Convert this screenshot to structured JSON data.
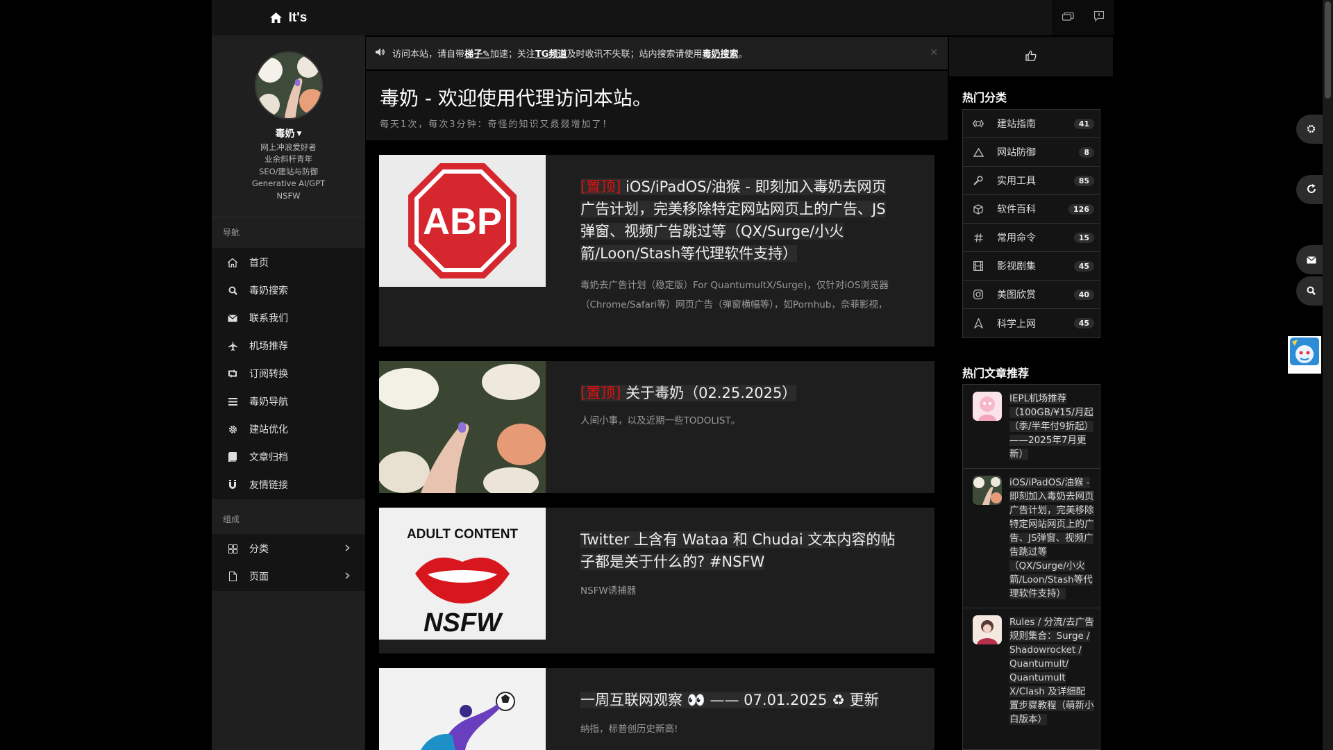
{
  "brand": {
    "title": "It's"
  },
  "profile": {
    "name": "毒奶",
    "bio": [
      "网上冲浪爱好者",
      "业余斜杆青年",
      "SEO/建站与防御",
      "Generative AI/GPT",
      "NSFW"
    ]
  },
  "nav": {
    "heading": "导航",
    "items": [
      {
        "label": "首页",
        "icon": "home-icon"
      },
      {
        "label": "毒奶搜索",
        "icon": "search-icon"
      },
      {
        "label": "联系我们",
        "icon": "envelope-icon"
      },
      {
        "label": "机场推荐",
        "icon": "plane-icon"
      },
      {
        "label": "订阅转换",
        "icon": "retweet-icon"
      },
      {
        "label": "毒奶导航",
        "icon": "list-icon"
      },
      {
        "label": "建站优化",
        "icon": "gear-icon"
      },
      {
        "label": "文章归档",
        "icon": "book-icon"
      },
      {
        "label": "友情链接",
        "icon": "magnet-icon"
      }
    ],
    "group_heading": "组成",
    "group_items": [
      {
        "label": "分类",
        "icon": "grid-icon"
      },
      {
        "label": "页面",
        "icon": "file-icon"
      }
    ]
  },
  "notice": {
    "prefix": "访问本站，请自带",
    "link1": "梯子✎",
    "mid1": "加速；关注 ",
    "link2": "TG频道 ",
    "mid2": "及时收讯不失联；站内搜索请使用",
    "link3": "毒奶搜索",
    "suffix": "。",
    "close": "✕"
  },
  "hero": {
    "title": "毒奶 - 欢迎使用代理访问本站。",
    "subtitle": "每天1次，每次3分钟：奇怪的知识又叒叕增加了！"
  },
  "posts": [
    {
      "pin": "[置顶]",
      "title": "iOS/iPadOS/油猴 - 即刻加入毒奶去网页广告计划，完美移除特定网站网页上的广告、JS弹窗、视频广告跳过等（QX/Surge/小火箭/Loon/Stash等代理软件支持）",
      "desc": "毒奶去广告计划（稳定版）For QuantumultX/Surge)，仅针对iOS浏览器（Chrome/Safari等）网页广告（弹窗横幅等），如Pornhub，奈菲影视，",
      "thumb_text": "ABP"
    },
    {
      "pin": "[置顶]",
      "title": "关于毒奶（02.25.2025）",
      "desc": "人间小事，以及近期一些TODOLIST。"
    },
    {
      "pin": "",
      "title": "Twitter 上含有 Wataa 和 Chudai 文本内容的帖子都是关于什么的? #NSFW",
      "desc": "NSFW诱捕器",
      "thumb_top": "ADULT CONTENT",
      "thumb_bottom": "NSFW"
    },
    {
      "pin": "",
      "title": "一周互联网观察 👀 —— 07.01.2025 ♻ 更新",
      "desc": "纳指，标普创历史新高!"
    }
  ],
  "right": {
    "hot_categories_title": "热门分类",
    "categories": [
      {
        "label": "建站指南",
        "count": "41",
        "icon": "code-icon"
      },
      {
        "label": "网站防御",
        "count": "8",
        "icon": "warning-icon"
      },
      {
        "label": "实用工具",
        "count": "85",
        "icon": "wrench-icon"
      },
      {
        "label": "软件百科",
        "count": "126",
        "icon": "cube-icon"
      },
      {
        "label": "常用命令",
        "count": "15",
        "icon": "hash-icon"
      },
      {
        "label": "影视剧集",
        "count": "45",
        "icon": "film-icon"
      },
      {
        "label": "美图欣赏",
        "count": "40",
        "icon": "instagram-icon"
      },
      {
        "label": "科学上网",
        "count": "45",
        "icon": "send-icon"
      }
    ],
    "hot_articles_title": "热门文章推荐",
    "articles": [
      {
        "title": "IEPL机场推荐（100GB/¥15/月起（季/半年付9折起）——2025年7月更新）"
      },
      {
        "title": "iOS/iPadOS/油猴 - 即刻加入毒奶去网页广告计划，完美移除特定网站网页上的广告、JS弹窗、视频广告跳过等（QX/Surge/小火箭/Loon/Stash等代理软件支持）"
      },
      {
        "title": "Rules / 分流/去广告规则集合：Surge / Shadowrocket / Quantumult/ Quantumult X/Clash 及详细配置步骤教程（萌新小白版本）"
      }
    ]
  },
  "colors": {
    "pin": "#e01010",
    "abp_red": "#d6262e",
    "bg": "#000000",
    "panel": "#1e1e1e"
  }
}
